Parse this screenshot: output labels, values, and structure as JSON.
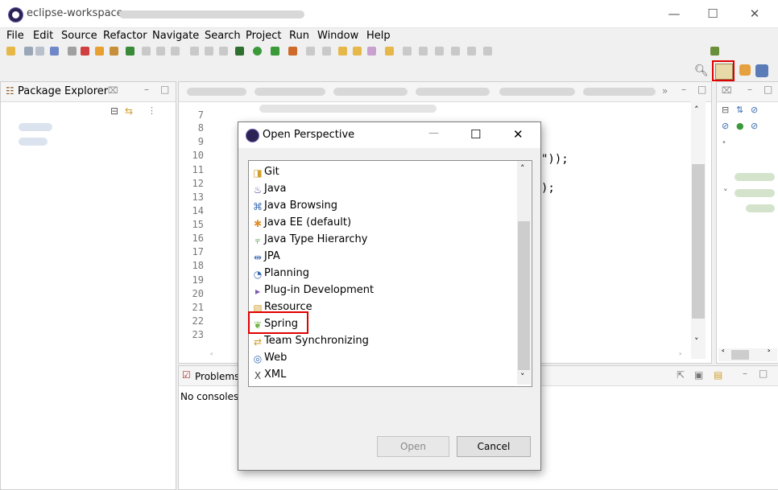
{
  "window": {
    "title": "eclipse-workspace",
    "controls": {
      "minimize": "—",
      "maximize": "☐",
      "close": "✕"
    }
  },
  "menu": [
    "File",
    "Edit",
    "Source",
    "Refactor",
    "Navigate",
    "Search",
    "Project",
    "Run",
    "Window",
    "Help"
  ],
  "package_explorer": {
    "title": "Package Explorer"
  },
  "editor": {
    "line_numbers": [
      "7",
      "8",
      "9",
      "10",
      "11",
      "12",
      "13",
      "14",
      "15",
      "16",
      "17",
      "18",
      "19",
      "20",
      "21",
      "22",
      "23"
    ],
    "code_fragments": {
      "line10_tail": "\"));",
      "line12_tail": ");"
    }
  },
  "console": {
    "tab_label": "Problems",
    "message": "No consoles"
  },
  "dialog": {
    "title": "Open Perspective",
    "controls": {
      "minimize": "—",
      "maximize": "☐",
      "close": "✕"
    },
    "perspectives": [
      {
        "label": "Git",
        "icon": "git-icon"
      },
      {
        "label": "Java",
        "icon": "java-icon"
      },
      {
        "label": "Java Browsing",
        "icon": "java-browsing-icon"
      },
      {
        "label": "Java EE (default)",
        "icon": "java-ee-icon"
      },
      {
        "label": "Java Type Hierarchy",
        "icon": "type-hierarchy-icon"
      },
      {
        "label": "JPA",
        "icon": "jpa-icon"
      },
      {
        "label": "Planning",
        "icon": "planning-icon"
      },
      {
        "label": "Plug-in Development",
        "icon": "plugin-icon"
      },
      {
        "label": "Resource",
        "icon": "resource-icon"
      },
      {
        "label": "Spring",
        "icon": "spring-icon"
      },
      {
        "label": "Team Synchronizing",
        "icon": "team-sync-icon"
      },
      {
        "label": "Web",
        "icon": "web-icon"
      },
      {
        "label": "XML",
        "icon": "xml-icon"
      }
    ],
    "highlighted_item": "Spring",
    "open_button": "Open",
    "cancel_button": "Cancel"
  },
  "colors": {
    "highlight": "#e00000",
    "spring_green": "#6db33f"
  }
}
